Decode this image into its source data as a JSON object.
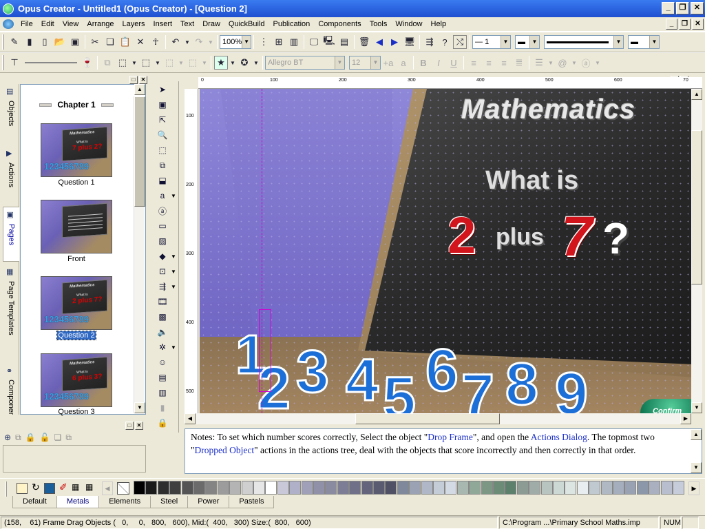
{
  "window": {
    "title": "Opus Creator - Untitled1 (Opus Creator) - [Question 2]"
  },
  "menu": [
    "File",
    "Edit",
    "View",
    "Arrange",
    "Layers",
    "Insert",
    "Text",
    "Draw",
    "QuickBuild",
    "Publication",
    "Components",
    "Tools",
    "Window",
    "Help"
  ],
  "toolbar": {
    "zoom": "100%",
    "line_width": "1",
    "font": "Allegro BT",
    "font_size": "12"
  },
  "side_tabs": [
    "Objects",
    "Actions",
    "Pages",
    "Page Templates",
    "Components"
  ],
  "pages": {
    "chapter": "Chapter 1",
    "items": [
      {
        "label": "Question 1",
        "selected": false,
        "thumb_title": "Mathematics",
        "thumb_q": "What is",
        "thumb_nums": "7 plus 2?"
      },
      {
        "label": "Front",
        "selected": false
      },
      {
        "label": "Question 2",
        "selected": true,
        "thumb_title": "Mathematics",
        "thumb_q": "What is",
        "thumb_nums": "2 plus 7?"
      },
      {
        "label": "Question 3",
        "selected": false,
        "thumb_title": "Mathematics",
        "thumb_q": "What is",
        "thumb_nums": "6 plus 3?"
      }
    ]
  },
  "ruler": {
    "x": [
      "0",
      "100",
      "200",
      "300",
      "400",
      "500",
      "600",
      "70"
    ],
    "y": [
      "100",
      "200",
      "300",
      "400",
      "500"
    ]
  },
  "canvas": {
    "title": "Mathematics",
    "question": "What is",
    "operand1": "2",
    "operator": "plus",
    "operand2": "7",
    "qmark": "?",
    "numbers": [
      "1",
      "2",
      "3",
      "4",
      "5",
      "6",
      "7",
      "8",
      "9"
    ],
    "confirm": "Confirm"
  },
  "notes": {
    "p1": "Notes: To set which number scores correctly, Select the object \"",
    "l1": "Drop Frame",
    "p2": "\", and open the ",
    "l2": "Actions Dialog",
    "p3": ". The topmost two \"",
    "l3": "Dropped Object",
    "p4": "\" actions in the actions tree, deal with the objects that score incorrectly and then correctly in that order."
  },
  "palette": {
    "tabs": [
      "Default",
      "Metals",
      "Elements",
      "Steel",
      "Power",
      "Pastels"
    ],
    "active": "Metals",
    "swatches": [
      "#000000",
      "#1a1a1a",
      "#2e2e2e",
      "#3f3f3f",
      "#545454",
      "#6b6b6b",
      "#848484",
      "#9c9c9c",
      "#b4b4b4",
      "#cfcfcf",
      "#e6e6e6",
      "#ffffff",
      "#c8c8d8",
      "#b0b0c8",
      "#a0a0b8",
      "#9090a8",
      "#8a8aa0",
      "#7d7d95",
      "#707088",
      "#64647c",
      "#5a5a70",
      "#515166",
      "#80889c",
      "#9aa2b4",
      "#b0b8c8",
      "#c4ccd8",
      "#d4dae4",
      "#a8b8b0",
      "#90a898",
      "#7c9884",
      "#6c8c78",
      "#5c806c",
      "#8c9c94",
      "#a0aca8",
      "#b8c4c0",
      "#ccd8d4",
      "#dde5e2",
      "#e8eef0",
      "#c0c8d0",
      "#b0b8c4",
      "#a4aebc",
      "#98a2b2",
      "#8c98aa",
      "#aab0c0",
      "#b8bece",
      "#c6ccda"
    ]
  },
  "status": {
    "coords": "(158,    61) Frame Drag Objects (   0,     0,   800,   600), Mid:(  400,   300) Size:(  800,   600)",
    "path": "C:\\Program ...\\Primary School Maths.imp",
    "num": "NUM"
  },
  "colors": {
    "accent": "#316ac5",
    "titlebar": "#2457d6",
    "selection_guide": "#d000d0"
  }
}
